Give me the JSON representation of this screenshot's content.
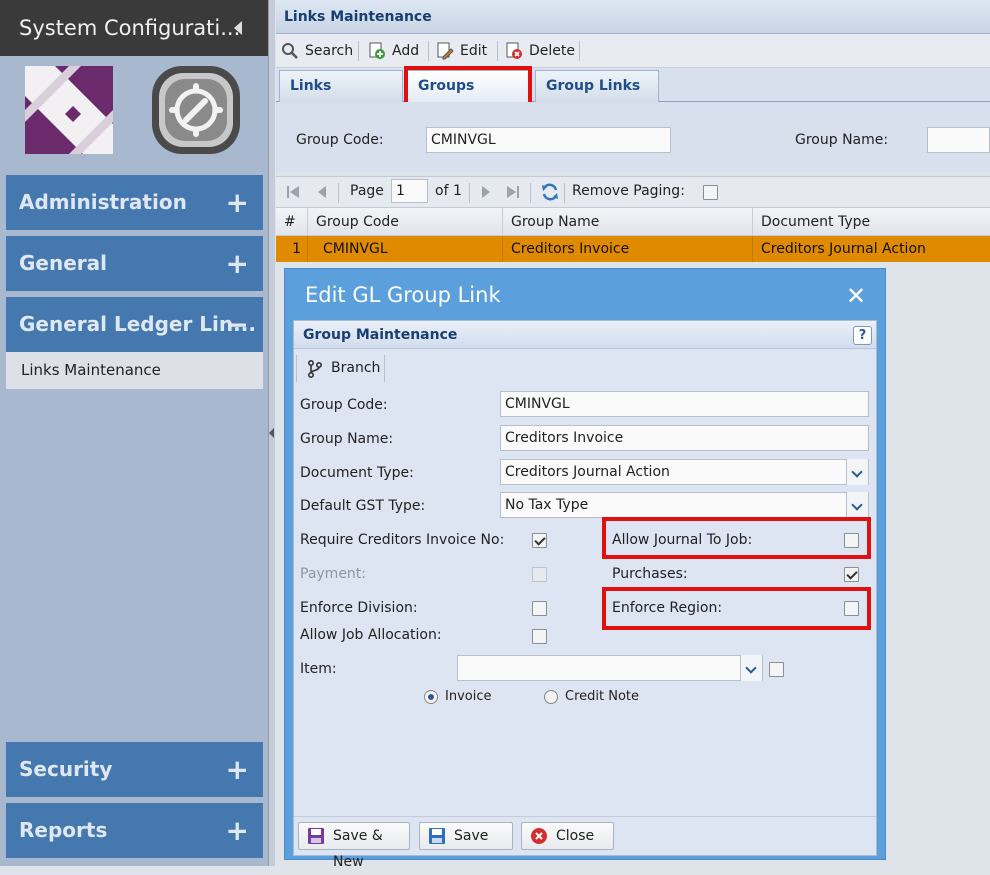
{
  "sidebar": {
    "title": "System Configurati...",
    "nav": [
      {
        "label": "Administration",
        "toggle": "+"
      },
      {
        "label": "General",
        "toggle": "+"
      },
      {
        "label": "General Ledger Lin...",
        "toggle": "−"
      },
      {
        "label": "Security",
        "toggle": "+"
      },
      {
        "label": "Reports",
        "toggle": "+"
      }
    ],
    "sub_item": "Links Maintenance"
  },
  "main": {
    "header": "Links Maintenance",
    "toolbar": {
      "search": "Search",
      "add": "Add",
      "edit": "Edit",
      "delete": "Delete"
    },
    "tabs": [
      "Links",
      "Groups",
      "Group Links"
    ],
    "active_tab": "Groups",
    "filter": {
      "group_code_label": "Group Code:",
      "group_code_value": "CMINVGL",
      "group_name_label": "Group Name:"
    },
    "pager": {
      "page_label": "Page",
      "page_value": "1",
      "of_label": "of 1",
      "remove_paging": "Remove Paging:"
    },
    "grid": {
      "columns": [
        "#",
        "Group Code",
        "Group Name",
        "Document Type"
      ],
      "rows": [
        [
          "1",
          "CMINVGL",
          "Creditors Invoice",
          "Creditors Journal Action"
        ]
      ]
    }
  },
  "dialog": {
    "title": "Edit GL Group Link",
    "close": "✕",
    "section": "Group Maintenance",
    "help": "?",
    "branch": "Branch",
    "fields": {
      "group_code_label": "Group Code:",
      "group_code": "CMINVGL",
      "group_name_label": "Group Name:",
      "group_name": "Creditors Invoice",
      "document_type_label": "Document Type:",
      "document_type": "Creditors Journal Action",
      "gst_label": "Default GST Type:",
      "gst": "No Tax Type",
      "require_invoice_label": "Require Creditors Invoice No:",
      "payment_label": "Payment:",
      "enforce_division_label": "Enforce Division:",
      "allow_job_alloc_label": "Allow Job Allocation:",
      "allow_journal_label": "Allow Journal To Job:",
      "purchases_label": "Purchases:",
      "enforce_region_label": "Enforce Region:",
      "item_label": "Item:",
      "invoice_label": "Invoice",
      "credit_note_label": "Credit Note"
    },
    "buttons": {
      "save_new": "Save & New",
      "save": "Save",
      "close": "Close"
    }
  },
  "colors": {
    "accent": "#4678b0",
    "selected_row": "#e08a00",
    "highlight": "#e01010",
    "dialog": "#5b9fdc"
  }
}
